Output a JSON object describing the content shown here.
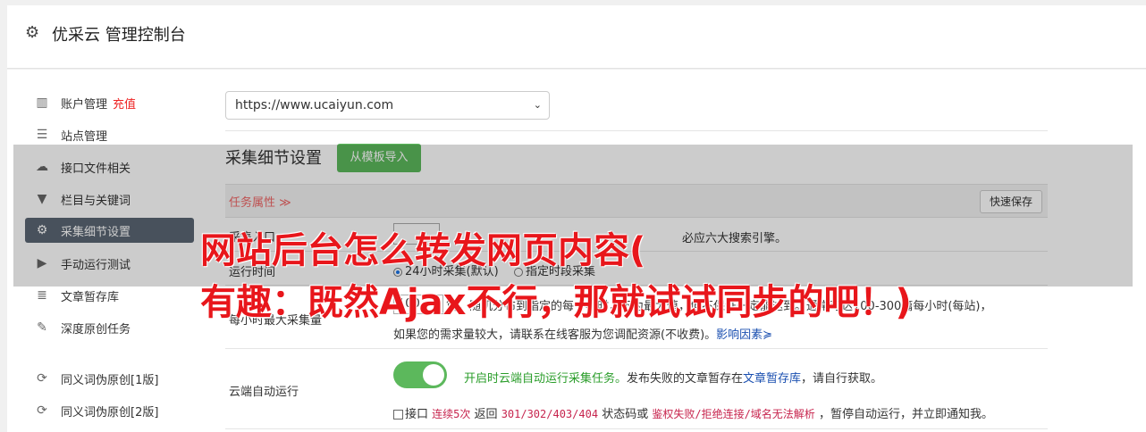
{
  "header": {
    "title": "优采云 管理控制台"
  },
  "sidebar": {
    "items": [
      {
        "icon": "bar-chart-icon",
        "label": "账户管理",
        "extra": "充值"
      },
      {
        "icon": "server-icon",
        "label": "站点管理"
      },
      {
        "icon": "cloud-upload-icon",
        "label": "接口文件相关"
      },
      {
        "icon": "filter-icon",
        "label": "栏目与关键词"
      },
      {
        "icon": "gears-icon",
        "label": "采集细节设置",
        "active": true
      },
      {
        "icon": "play-circle-icon",
        "label": "手动运行测试"
      },
      {
        "icon": "database-icon",
        "label": "文章暂存库"
      },
      {
        "icon": "edit-icon",
        "label": "深度原创任务"
      },
      {
        "icon": "refresh-icon",
        "label": "同义词伪原创[1版]"
      },
      {
        "icon": "refresh-icon",
        "label": "同义词伪原创[2版]"
      }
    ]
  },
  "site_select": {
    "value": "https://www.ucaiyun.com"
  },
  "section": {
    "title": "采集细节设置",
    "import_button": "从模板导入"
  },
  "task": {
    "label": "任务属性 ≫",
    "save_button": "快速保存"
  },
  "rows": {
    "row1_label": "采集入口",
    "row1_text": "必应六大搜索引擎。",
    "runtime_label": "运行时间",
    "runtime_opt1": "24小时采集(默认)",
    "runtime_opt2": "指定时段采集",
    "max_label": "每小时最大采集量",
    "max_value": "100",
    "max_text": "篇，随机分布到指定的每个小时，不为最大值，但不保证一定能达到。通常可达100-300篇每小时(每站)，",
    "max_text2": "如果您的需求量较大，请联系在线客服为您调配资源(不收费)。",
    "max_link": "影响因素",
    "cloud_label": "云端自动运行",
    "cloud_desc_green": "开启时云端自动运行采集任务。",
    "cloud_desc": "发布失败的文章暂存在",
    "cloud_link": "文章暂存库",
    "cloud_desc2": "，请自行获取。",
    "cb_a": "接口",
    "cb_code1": "连续5次",
    "cb_b": "返回",
    "cb_code2": "301/302/403/404",
    "cb_c": "状态码或",
    "cb_code3": "鉴权失败/拒绝连接/域名无法解析",
    "cb_d": "，暂停自动运行，并立即通知我。"
  },
  "overlay_headline": {
    "line1": "网站后台怎么转发网页内容(",
    "line2": "有趣：既然Ajax不行，那就试试同步的吧！)"
  }
}
